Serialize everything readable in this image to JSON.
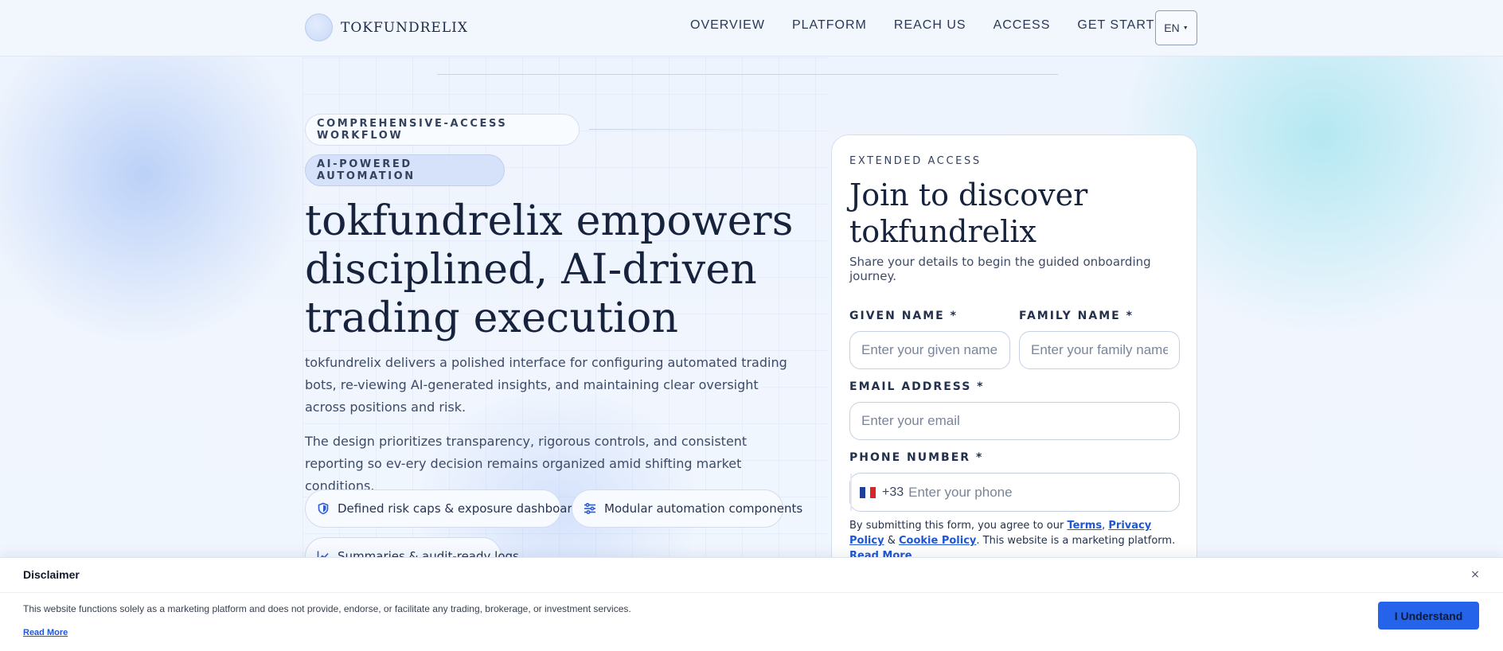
{
  "header": {
    "logo_text": "TOKFUNDRELIX",
    "nav": [
      {
        "label": "OVERVIEW"
      },
      {
        "label": "PLATFORM"
      },
      {
        "label": "REACH US"
      },
      {
        "label": "ACCESS"
      },
      {
        "label": "GET STARTED"
      }
    ],
    "language": "EN"
  },
  "hero": {
    "pill_1": "COMPREHENSIVE-ACCESS WORKFLOW",
    "pill_2": "AI-POWERED AUTOMATION",
    "headline": "tokfundrelix empowers disciplined, AI-driven trading execution",
    "paragraph_1": "tokfundrelix delivers a polished interface for configuring automated trading bots, re-viewing AI-generated insights, and maintaining clear oversight across positions and risk.",
    "paragraph_2": "The design prioritizes transparency, rigorous controls, and consistent reporting so ev-ery decision remains organized amid shifting market conditions.",
    "features": [
      {
        "label": "Defined risk caps & exposure dashboards",
        "icon": "shield-icon"
      },
      {
        "label": "Modular automation components",
        "icon": "sliders-icon"
      },
      {
        "label": "Summaries & audit-ready logs",
        "icon": "chart-line-icon"
      }
    ]
  },
  "form": {
    "eyebrow": "EXTENDED ACCESS",
    "title": "Join to discover tokfundrelix",
    "subtitle": "Share your details to begin the guided onboarding journey.",
    "given_name_label": "GIVEN NAME *",
    "given_name_placeholder": "Enter your given name",
    "family_name_label": "FAMILY NAME *",
    "family_name_placeholder": "Enter your family name",
    "email_label": "EMAIL ADDRESS *",
    "email_placeholder": "Enter your email",
    "phone_label": "PHONE NUMBER *",
    "phone_code": "+33",
    "phone_placeholder": "Enter your phone",
    "consent_prefix": "By submitting this form, you agree to our",
    "terms_link": "Terms",
    "comma": ",",
    "privacy_link": "Privacy Policy",
    "amp": "&",
    "cookie_link": "Cookie Policy",
    "consent_suffix": ". This website is a marketing platform.",
    "read_more_link": "Read More"
  },
  "disclaimer": {
    "title": "Disclaimer",
    "close": "×",
    "text": "This website functions solely as a marketing platform and does not provide, endorse, or facilitate any trading, brokerage, or investment services.",
    "read_more": "Read More",
    "button": "I Understand"
  }
}
